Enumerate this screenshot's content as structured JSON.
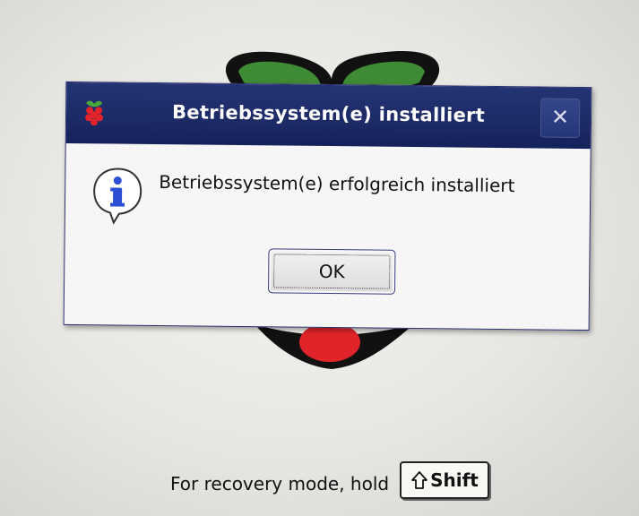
{
  "dialog": {
    "title": "Betriebssystem(e) installiert",
    "close_glyph": "✕",
    "message": "Betriebssystem(e) erfolgreich installiert",
    "ok_label": "OK",
    "icons": {
      "title": "raspberry-pi-logo-icon",
      "message": "info-speech-bubble-icon"
    }
  },
  "footer": {
    "recovery_text": "For recovery mode, hold",
    "shift_label": "Shift",
    "shift_icon": "shift-arrow-icon"
  },
  "colors": {
    "titlebar": "#1c2a66",
    "dialog_bg": "#f6f6f6",
    "raspberry_red": "#e0242a",
    "leaf_green": "#3f8a35",
    "info_blue": "#2d4fd6"
  }
}
